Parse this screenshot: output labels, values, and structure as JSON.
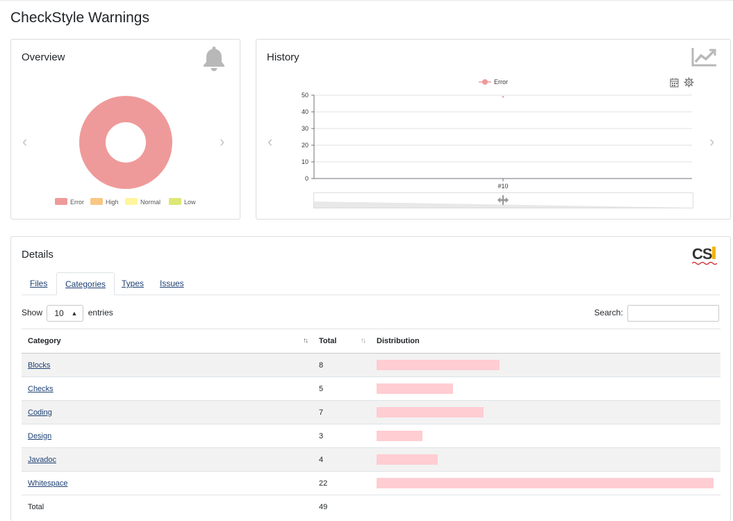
{
  "page": {
    "title": "CheckStyle Warnings"
  },
  "overview": {
    "title": "Overview",
    "icon": "bell-icon",
    "legend": [
      {
        "label": "Error",
        "color": "#ef9a9a"
      },
      {
        "label": "High",
        "color": "#f9c784"
      },
      {
        "label": "Normal",
        "color": "#fff59d"
      },
      {
        "label": "Low",
        "color": "#dce775"
      }
    ],
    "chart": {
      "type": "donut",
      "slices": [
        {
          "label": "Error",
          "value": 49,
          "color": "#ef9a9a"
        }
      ]
    }
  },
  "history": {
    "title": "History",
    "icon": "trend-chart-icon",
    "toolbar_icons": [
      "calendar-icon",
      "gear-icon"
    ]
  },
  "chart_data": [
    {
      "type": "pie",
      "categories": [
        "Error",
        "High",
        "Normal",
        "Low"
      ],
      "values": [
        49,
        0,
        0,
        0
      ],
      "colors": [
        "#ef9a9a",
        "#f9c784",
        "#fff59d",
        "#dce775"
      ],
      "legend": "bottom"
    },
    {
      "type": "line",
      "x": [
        "#10"
      ],
      "series": [
        {
          "name": "Error",
          "values": [
            49
          ],
          "color": "#ef9a9a"
        }
      ],
      "yticks": [
        "0",
        "10",
        "20",
        "30",
        "40",
        "50"
      ],
      "ylim": [
        0,
        50
      ],
      "legend": "top",
      "grid": true
    }
  ],
  "details": {
    "title": "Details",
    "logo_text": "CS",
    "tabs": [
      "Files",
      "Categories",
      "Types",
      "Issues"
    ],
    "active_tab": "Categories",
    "show_label": "Show",
    "entries_value": "10",
    "entries_label": "entries",
    "search_label": "Search:",
    "search_value": "",
    "columns": [
      "Category",
      "Total",
      "Distribution"
    ],
    "rows": [
      {
        "category": "Blocks",
        "total": "8",
        "ratio": 0.364
      },
      {
        "category": "Checks",
        "total": "5",
        "ratio": 0.227
      },
      {
        "category": "Coding",
        "total": "7",
        "ratio": 0.318
      },
      {
        "category": "Design",
        "total": "3",
        "ratio": 0.136
      },
      {
        "category": "Javadoc",
        "total": "4",
        "ratio": 0.182
      },
      {
        "category": "Whitespace",
        "total": "22",
        "ratio": 1.0
      }
    ],
    "footer": {
      "label": "Total",
      "total": "49"
    },
    "bar_color": "#ffcdd2"
  }
}
